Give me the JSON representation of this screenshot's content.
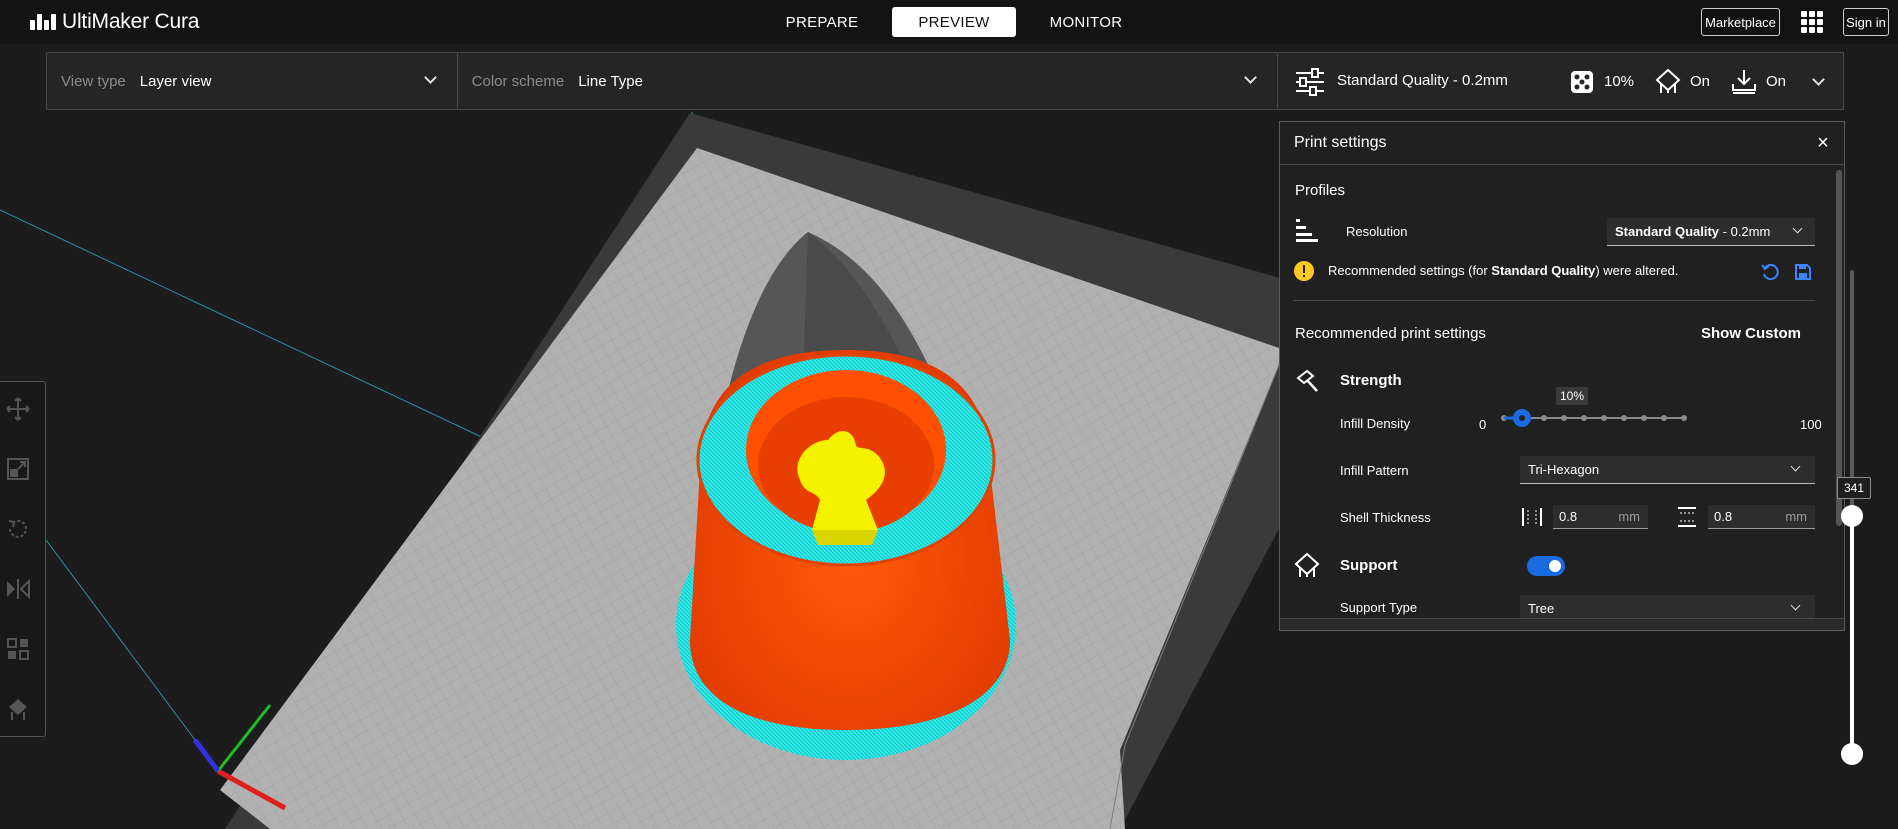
{
  "app": {
    "logo_text": "UltiMaker Cura",
    "colors": {
      "accent_blue": "#1a6ae0",
      "outer_wall": "#ff4f00",
      "infill": "#2ef0ef",
      "inner_feature": "#ffff00",
      "build_plate": "#b3b3b3"
    }
  },
  "header": {
    "tabs": [
      {
        "label": "PREPARE",
        "active": false
      },
      {
        "label": "PREVIEW",
        "active": true
      },
      {
        "label": "MONITOR",
        "active": false
      }
    ],
    "marketplace_label": "Marketplace",
    "apps_icon": "grid-apps-icon",
    "sign_in_label": "Sign in"
  },
  "view_bar": {
    "view_type_label": "View type",
    "view_type_value": "Layer view",
    "color_scheme_label": "Color scheme",
    "color_scheme_value": "Line Type"
  },
  "print_bar": {
    "profile": "Standard Quality - 0.2mm",
    "infill": "10%",
    "support": "On",
    "adhesion": "On"
  },
  "left_tools": [
    "move-tool-icon",
    "scale-tool-icon",
    "rotate-tool-icon",
    "mirror-tool-icon",
    "per-model-settings-icon",
    "support-blocker-icon"
  ],
  "panel": {
    "title": "Print settings",
    "profiles_heading": "Profiles",
    "resolution_label": "Resolution",
    "resolution_value_bold": "Standard Quality",
    "resolution_value_rest": " - 0.2mm",
    "notice_prefix": "Recommended settings (for ",
    "notice_bold": "Standard Quality",
    "notice_suffix": ") were altered.",
    "recommended_heading": "Recommended print settings",
    "show_custom_label": "Show Custom",
    "strength_heading": "Strength",
    "infill_density_label": "Infill Density",
    "infill_density_min": "0",
    "infill_density_max": "100",
    "infill_density_tooltip": "10%",
    "infill_density_value": 10,
    "infill_pattern_label": "Infill Pattern",
    "infill_pattern_value": "Tri-Hexagon",
    "shell_thickness_label": "Shell Thickness",
    "wall_thickness_value": "0.8",
    "top_bottom_thickness_value": "0.8",
    "unit_mm": "mm",
    "support_heading": "Support",
    "support_enabled": true,
    "support_type_label": "Support Type",
    "support_type_value": "Tree"
  },
  "layer_slider": {
    "current_layer": "341"
  }
}
